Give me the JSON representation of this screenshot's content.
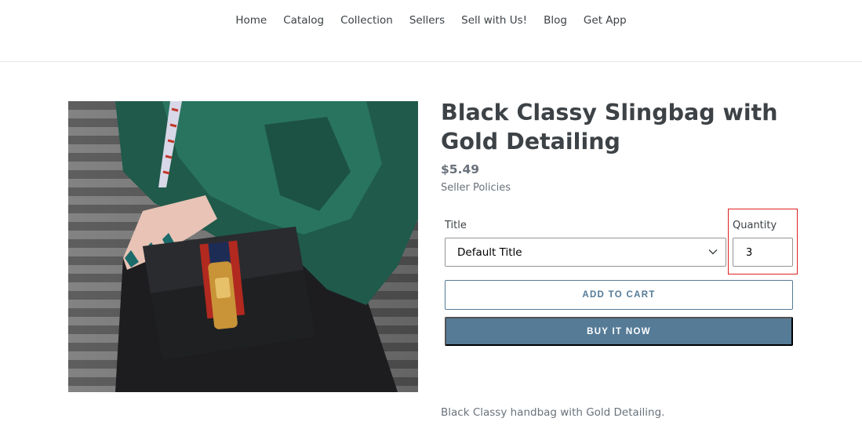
{
  "nav": {
    "items": [
      {
        "label": "Home"
      },
      {
        "label": "Catalog"
      },
      {
        "label": "Collection"
      },
      {
        "label": "Sellers"
      },
      {
        "label": "Sell with Us!"
      },
      {
        "label": "Blog"
      },
      {
        "label": "Get App"
      }
    ]
  },
  "product": {
    "title": "Black Classy Slingbag with Gold Detailing",
    "price": "$5.49",
    "seller_policies_label": "Seller Policies",
    "description": "Black Classy handbag with Gold Detailing.",
    "image_icon": "product-photo"
  },
  "form": {
    "title_label": "Title",
    "title_selected": "Default Title",
    "quantity_label": "Quantity",
    "quantity_value": "3",
    "add_to_cart_label": "ADD TO CART",
    "buy_now_label": "BUY IT NOW"
  },
  "colors": {
    "accent": "#557b97",
    "highlight": "#e02020",
    "text": "#3d4246",
    "muted": "#69727b"
  }
}
